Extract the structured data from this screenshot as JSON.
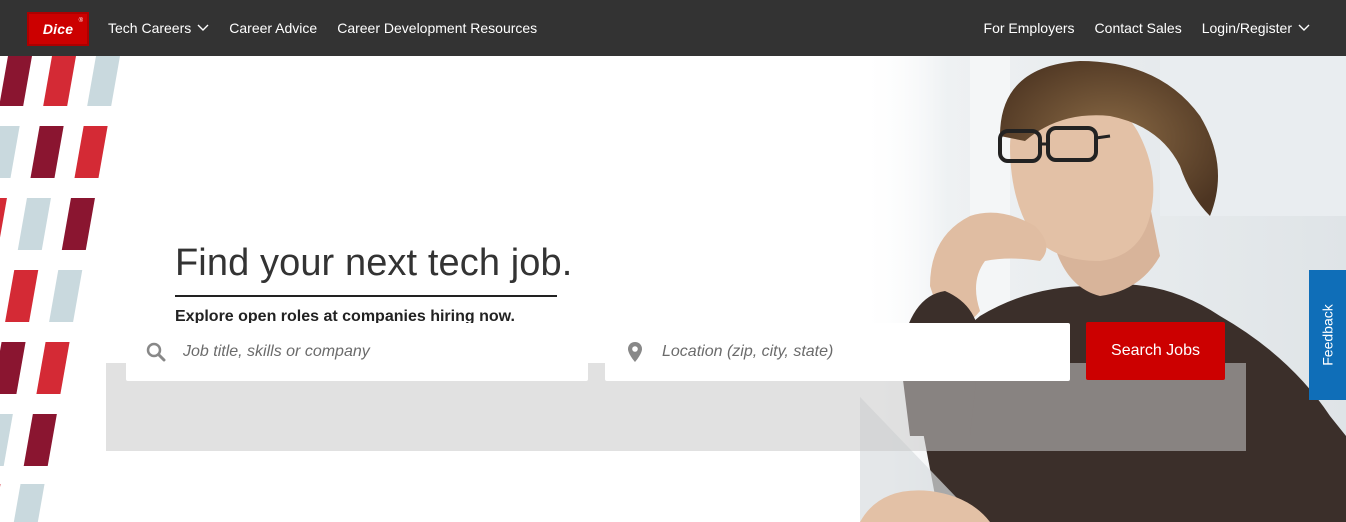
{
  "brand": {
    "logo_text": "Dice",
    "logo_mark": "®",
    "accent": "#cc0000"
  },
  "nav": {
    "left": [
      {
        "label": "Tech Careers",
        "has_dropdown": true
      },
      {
        "label": "Career Advice",
        "has_dropdown": false
      },
      {
        "label": "Career Development Resources",
        "has_dropdown": false
      }
    ],
    "right": [
      {
        "label": "For Employers",
        "has_dropdown": false
      },
      {
        "label": "Contact Sales",
        "has_dropdown": false
      },
      {
        "label": "Login/Register",
        "has_dropdown": true
      }
    ],
    "background": "#333333"
  },
  "hero": {
    "headline": "Find your next tech job.",
    "subhead": "Explore open roles at companies hiring now."
  },
  "search": {
    "job_placeholder": "Job title, skills or company",
    "job_value": "",
    "job_icon": "search-icon",
    "location_placeholder": "Location (zip, city, state)",
    "location_value": "",
    "location_icon": "location-pin-icon",
    "button_label": "Search Jobs",
    "button_color": "#cc0000"
  },
  "feedback": {
    "label": "Feedback",
    "color": "#0f6eb8"
  }
}
